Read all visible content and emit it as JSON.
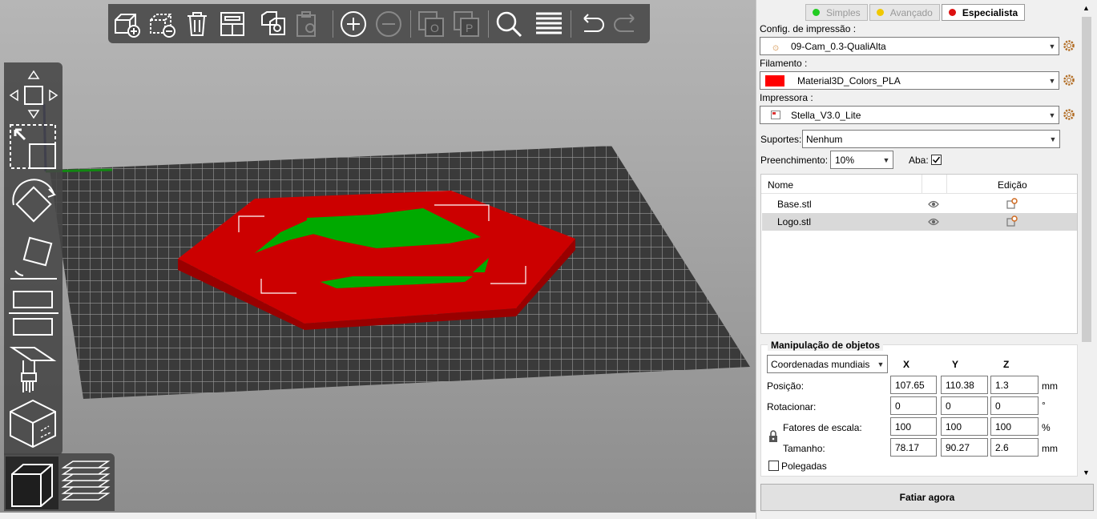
{
  "mode_tabs": [
    {
      "label": "Simples",
      "color": "#22cc22",
      "active": false
    },
    {
      "label": "Avançado",
      "color": "#f0c800",
      "active": false
    },
    {
      "label": "Especialista",
      "color": "#dd1111",
      "active": true
    }
  ],
  "print_config": {
    "label": "Config. de impressão :",
    "value": "09-Cam_0.3-QualiAlta"
  },
  "filament": {
    "label": "Filamento :",
    "value": "Material3D_Colors_PLA",
    "swatch_color": "#ff0000"
  },
  "printer": {
    "label": "Impressora :",
    "value": "Stella_V3.0_Lite"
  },
  "supports": {
    "label": "Suportes:",
    "value": "Nenhum"
  },
  "infill": {
    "label": "Preenchimento:",
    "value": "10%"
  },
  "brim": {
    "label": "Aba:",
    "checked": true
  },
  "object_list": {
    "columns": {
      "name": "Nome",
      "edit": "Edição"
    },
    "items": [
      {
        "name": "Base.stl",
        "selected": false
      },
      {
        "name": "Logo.stl",
        "selected": true
      }
    ]
  },
  "manipulation": {
    "title": "Manipulação de objetos",
    "coord_system": "Coordenadas mundiais",
    "axes": [
      "X",
      "Y",
      "Z"
    ],
    "position": {
      "label": "Posição:",
      "x": "107.65",
      "y": "110.38",
      "z": "1.3",
      "unit": "mm"
    },
    "rotation": {
      "label": "Rotacionar:",
      "x": "0",
      "y": "0",
      "z": "0",
      "unit": "°"
    },
    "scale": {
      "label": "Fatores de escala:",
      "x": "100",
      "y": "100",
      "z": "100",
      "unit": "%"
    },
    "size": {
      "label": "Tamanho:",
      "x": "78.17",
      "y": "90.27",
      "z": "2.6",
      "unit": "mm"
    },
    "inches_label": "Polegadas"
  },
  "slice_button": "Fatiar agora",
  "colors": {
    "base_model": "#cc0000",
    "logo_model": "#00aa00",
    "bed_grid": "#3a3a3a",
    "toolbar_bg": "#464646"
  }
}
